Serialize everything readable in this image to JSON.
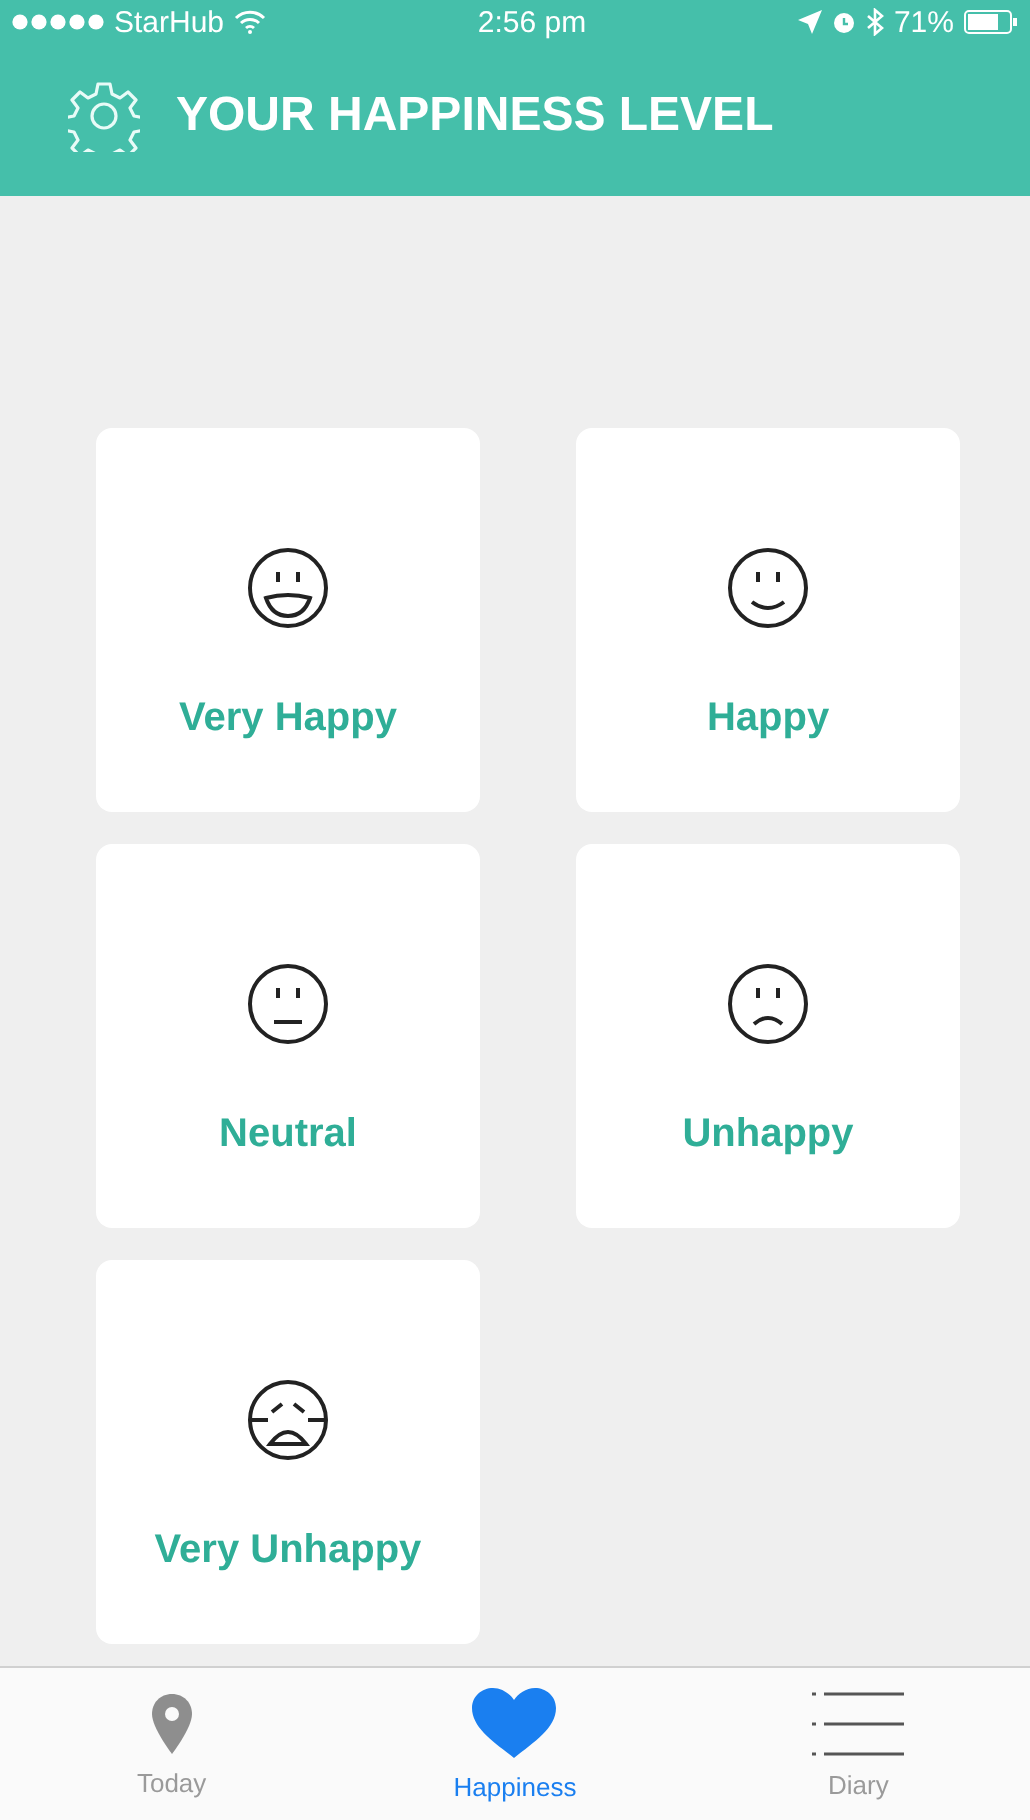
{
  "status_bar": {
    "carrier": "StarHub",
    "time": "2:56 pm",
    "battery": "71%"
  },
  "header": {
    "title": "YOUR HAPPINESS LEVEL"
  },
  "moods": [
    {
      "kind": "very_happy",
      "label": "Very Happy"
    },
    {
      "kind": "happy",
      "label": "Happy"
    },
    {
      "kind": "neutral",
      "label": "Neutral"
    },
    {
      "kind": "unhappy",
      "label": "Unhappy"
    },
    {
      "kind": "very_unhappy",
      "label": "Very Unhappy"
    }
  ],
  "tabs": [
    {
      "kind": "pin",
      "label": "Today",
      "selected": false
    },
    {
      "kind": "heart",
      "label": "Happiness",
      "selected": true
    },
    {
      "kind": "list",
      "label": "Diary",
      "selected": false
    }
  ]
}
